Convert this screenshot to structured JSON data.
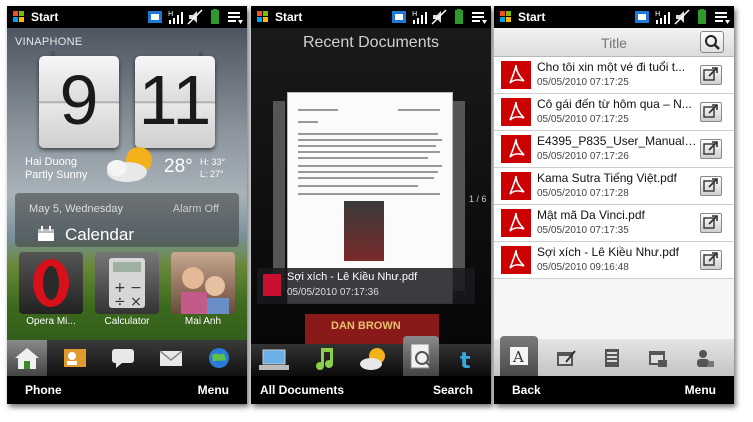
{
  "statusbar": {
    "start_label": "Start",
    "signal_glyph": "H"
  },
  "home": {
    "operator": "VINAPHONE",
    "clock": {
      "hour": "9",
      "minute": "11"
    },
    "weather": {
      "city": "Hai Duong",
      "condition": "Partly Sunny",
      "temperature": "28°",
      "high": "H: 33°",
      "low": "L: 27°"
    },
    "calendar": {
      "date": "May 5, Wednesday",
      "alarm": "Alarm Off",
      "label": "Calendar"
    },
    "tiles": [
      {
        "label": "Opera Mi..."
      },
      {
        "label": "Calculator"
      },
      {
        "label": "Mai Anh"
      }
    ],
    "dock_icons": [
      "home-icon",
      "contacts-icon",
      "messages-icon",
      "mail-icon",
      "internet-icon"
    ],
    "soft_left": "Phone",
    "soft_right": "Menu"
  },
  "recent": {
    "title": "Recent Documents",
    "page_indicator": "1 / 6",
    "current_doc": {
      "name": "Sợi xích - Lê Kiều Như.pdf",
      "time": "05/05/2010 07:17:36"
    },
    "next_cover_text": "DAN BROWN",
    "soft_left": "All Documents",
    "soft_right": "Search"
  },
  "docs_list": {
    "title": "Title",
    "items": [
      {
        "name": "Cho tôi xin một vé đi tuổi t...",
        "time": "05/05/2010 07:17:25"
      },
      {
        "name": "Cô gái đến từ hôm qua – N...",
        "time": "05/05/2010 07:17:25"
      },
      {
        "name": "E4395_P835_User_Manual....",
        "time": "05/05/2010 07:17:26"
      },
      {
        "name": "Kama Sutra Tiếng Việt.pdf",
        "time": "05/05/2010 07:17:28"
      },
      {
        "name": "Mật mã Da Vinci.pdf",
        "time": "05/05/2010 07:17:35"
      },
      {
        "name": "Sợi xích - Lê Kiều Như.pdf",
        "time": "05/05/2010 09:16:48"
      }
    ],
    "soft_left": "Back",
    "soft_right": "Menu"
  },
  "colors": {
    "pdf_red": "#c00000",
    "windows_red": "#f25022",
    "windows_green": "#7fba00",
    "windows_blue": "#00a4ef",
    "windows_yellow": "#ffb900"
  }
}
